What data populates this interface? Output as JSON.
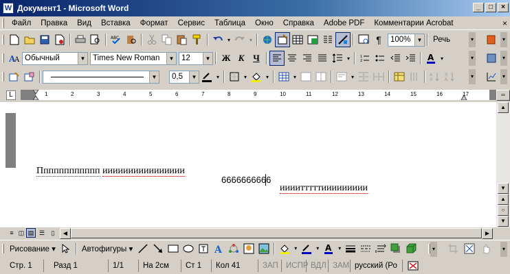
{
  "window": {
    "title": "Документ1 - Microsoft Word",
    "controls": [
      "_",
      "□",
      "×"
    ]
  },
  "menubar": {
    "items": [
      "Файл",
      "Правка",
      "Вид",
      "Вставка",
      "Формат",
      "Сервис",
      "Таблица",
      "Окно",
      "Справка",
      "Adobe PDF",
      "Комментарии Acrobat"
    ],
    "close": "×"
  },
  "standard_toolbar": {
    "zoom": "100%",
    "read_label": "Речь"
  },
  "format_toolbar": {
    "style": "Обычный",
    "font": "Times New Roman",
    "size": "12",
    "bold": "Ж",
    "italic": "К",
    "underline": "Ч"
  },
  "tables_toolbar": {
    "line_weight": "0,5"
  },
  "ruler": {
    "ticks": [
      "1",
      "2",
      "3",
      "4",
      "5",
      "6",
      "7",
      "8",
      "9",
      "10",
      "11",
      "12",
      "13",
      "14",
      "15",
      "16",
      "17"
    ]
  },
  "document": {
    "line1_word1": "Пппппппппппп",
    "line1_word2": "ииииииииииииииии",
    "line1_word3": "6666666666",
    "line2_word1": "иииитттттиииииииии"
  },
  "drawing_toolbar": {
    "draw_label": "Рисование",
    "autoshapes_label": "Автофигуры"
  },
  "statusbar": {
    "page": "Стр. 1",
    "section": "Разд 1",
    "pages": "1/1",
    "at": "На 2см",
    "line": "Ст 1",
    "col": "Кол 41",
    "rec": "ЗАП",
    "trk": "ИСПР",
    "ext": "ВДЛ",
    "ovr": "ЗАМ",
    "language": "русский (Ро"
  }
}
